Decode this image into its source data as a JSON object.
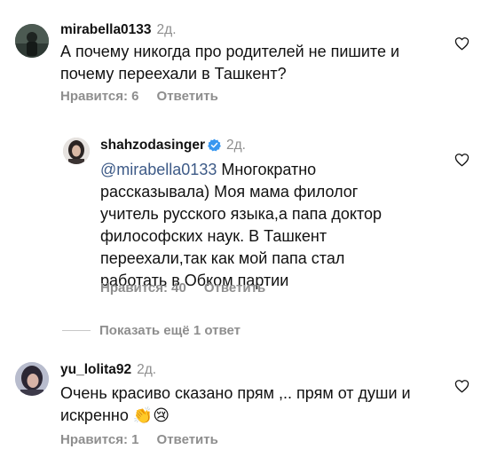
{
  "comments": [
    {
      "username": "mirabella0133",
      "time": "2д.",
      "text": "А почему никогда про родителей не пишите и почему переехали в Ташкент?",
      "likes": "Нравится: 6",
      "reply": "Ответить",
      "avatar_icon": "avatar-photo"
    },
    {
      "username": "shahzodasinger",
      "time": "2д.",
      "verified": true,
      "mention": "@mirabella0133",
      "text": " Многократно рассказывала) Моя мама филолог учитель русского языка,а папа доктор философских наук. В Ташкент переехали,так как мой папа  стал работать в Обком партии",
      "likes": "Нравится: 40",
      "reply": "Ответить",
      "avatar_icon": "avatar-photo"
    },
    {
      "username": "yu_lolita92",
      "time": "2д.",
      "text": "Очень красиво сказано прям ,.. прям от души и искренно 👏😢",
      "likes": "Нравится: 1",
      "reply": "Ответить",
      "avatar_icon": "avatar-photo"
    }
  ],
  "more_replies": "Показать ещё 1 ответ",
  "colors": {
    "meta_gray": "#8e8e8e",
    "mention": "#3d5a87",
    "verified_blue": "#3897f0"
  }
}
